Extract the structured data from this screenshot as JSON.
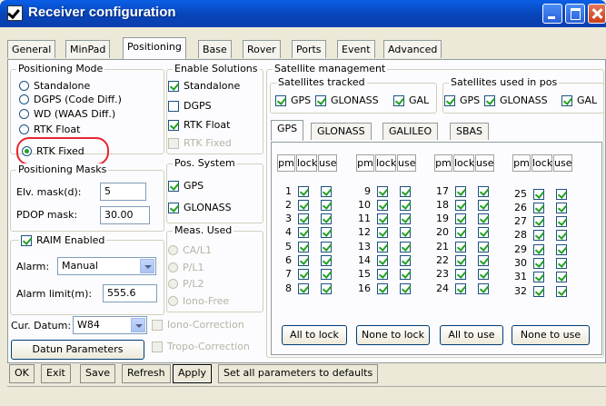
{
  "window": {
    "title": "Receiver configuration",
    "accent_color": "#0744b8",
    "highlight_color": "#e8262f"
  },
  "tabs": [
    {
      "label": "General",
      "active": false
    },
    {
      "label": "MinPad",
      "active": false
    },
    {
      "label": "Positioning",
      "active": true
    },
    {
      "label": "Base",
      "active": false
    },
    {
      "label": "Rover",
      "active": false
    },
    {
      "label": "Ports",
      "active": false
    },
    {
      "label": "Event",
      "active": false
    },
    {
      "label": "Advanced",
      "active": false
    }
  ],
  "positioning_mode": {
    "title": "Positioning Mode",
    "options": [
      {
        "label": "Standalone",
        "selected": false
      },
      {
        "label": "DGPS (Code Diff.)",
        "selected": false
      },
      {
        "label": "WD (WAAS Diff.)",
        "selected": false
      },
      {
        "label": "RTK Float",
        "selected": false
      },
      {
        "label": "RTK Fixed",
        "selected": true
      }
    ]
  },
  "positioning_masks": {
    "title": "Positioning Masks",
    "elv_label": "Elv. mask(d):",
    "elv_value": "5",
    "pdop_label": "PDOP mask:",
    "pdop_value": "30.00"
  },
  "raim": {
    "label": "RAIM Enabled",
    "checked": true,
    "alarm_label": "Alarm:",
    "alarm_value": "Manual",
    "alarm_limit_label": "Alarm limit(m):",
    "alarm_limit_value": "555.6"
  },
  "datum": {
    "label": "Cur. Datum:",
    "value": "W84",
    "params_button": "Datun Parameters"
  },
  "enable_solutions": {
    "title": "Enable Solutions",
    "items": [
      {
        "label": "Standalone",
        "checked": true,
        "disabled": false
      },
      {
        "label": "DGPS",
        "checked": false,
        "disabled": false
      },
      {
        "label": "RTK Float",
        "checked": true,
        "disabled": false
      },
      {
        "label": "RTK Fixed",
        "checked": false,
        "disabled": true
      }
    ]
  },
  "pos_system": {
    "title": "Pos. System",
    "items": [
      {
        "label": "GPS",
        "checked": true
      },
      {
        "label": "GLONASS",
        "checked": true
      }
    ]
  },
  "meas_used": {
    "title": "Meas. Used",
    "items": [
      "CA/L1",
      "P/L1",
      "P/L2",
      "Iono-Free"
    ]
  },
  "corrections": {
    "iono": "Iono-Correction",
    "tropo": "Tropo-Correction"
  },
  "satellite_management": {
    "title": "Satellite management",
    "tracked_title": "Satellites tracked",
    "tracked": [
      {
        "label": "GPS",
        "checked": true
      },
      {
        "label": "GLONASS",
        "checked": true
      },
      {
        "label": "GAL",
        "checked": true
      }
    ],
    "used_title": "Satellites used in pos",
    "used": [
      {
        "label": "GPS",
        "checked": true
      },
      {
        "label": "GLONASS",
        "checked": true
      },
      {
        "label": "GAL",
        "checked": true
      }
    ],
    "subtabs": [
      {
        "label": "GPS",
        "active": true
      },
      {
        "label": "GLONASS",
        "active": false
      },
      {
        "label": "GALILEO",
        "active": false
      },
      {
        "label": "SBAS",
        "active": false
      }
    ],
    "headers": [
      "pm",
      "lock",
      "use"
    ],
    "satellite_numbers": [
      [
        1,
        2,
        3,
        4,
        5,
        6,
        7,
        8
      ],
      [
        9,
        10,
        11,
        12,
        13,
        14,
        15,
        16
      ],
      [
        17,
        18,
        19,
        20,
        21,
        22,
        23,
        24
      ],
      [
        25,
        26,
        27,
        28,
        29,
        30,
        31,
        32
      ]
    ],
    "all_locked": true,
    "all_used": true,
    "buttons": [
      "All to lock",
      "None to lock",
      "All to use",
      "None to use"
    ]
  },
  "bottom_buttons": [
    {
      "label": "OK",
      "focused": false
    },
    {
      "label": "Exit",
      "focused": false
    },
    {
      "label": "Save",
      "focused": false
    },
    {
      "label": "Refresh",
      "focused": false
    },
    {
      "label": "Apply",
      "focused": true
    },
    {
      "label": "Set all parameters to defaults",
      "focused": false
    }
  ]
}
